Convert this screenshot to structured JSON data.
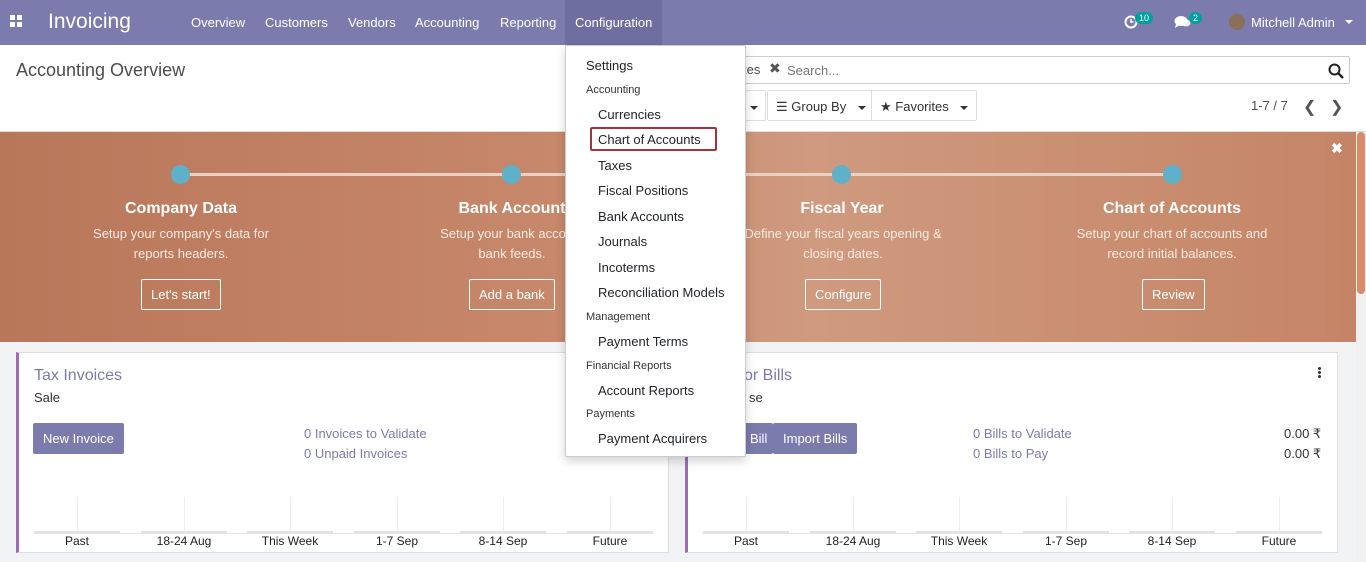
{
  "navbar": {
    "brand": "Invoicing",
    "menu": [
      "Overview",
      "Customers",
      "Vendors",
      "Accounting",
      "Reporting",
      "Configuration"
    ],
    "activity_count": "10",
    "message_count": "2",
    "user_name": "Mitchell Admin",
    "icons": [
      "apps-grid-icon",
      "clock-icon",
      "chat-icon",
      "avatar"
    ]
  },
  "control": {
    "title": "Accounting Overview",
    "facet_label": "tes",
    "search_placeholder": "Search...",
    "group_by": "Group By",
    "favorites": "Favorites",
    "pager": "1-7 / 7"
  },
  "banner": {
    "steps": [
      {
        "title": "Company Data",
        "desc1": "Setup your company's data for",
        "desc2": "reports headers.",
        "button": "Let's start!"
      },
      {
        "title": "Bank Account",
        "desc1": "Setup your bank account",
        "desc2": "bank feeds.",
        "button": "Add a bank"
      },
      {
        "title": "Fiscal Year",
        "desc1": "Define your fiscal years opening &",
        "desc2": "closing dates.",
        "button": "Configure"
      },
      {
        "title": "Chart of Accounts",
        "desc1": "Setup your chart of accounts and",
        "desc2": "record initial balances.",
        "button": "Review"
      }
    ],
    "close": "✖"
  },
  "cards": {
    "tax": {
      "title": "Tax Invoices",
      "subtitle": "Sale",
      "button": "New Invoice",
      "link1": "0 Invoices to Validate",
      "link2": "0 Unpaid Invoices"
    },
    "vendor": {
      "title": "or Bills",
      "subtitle": "se",
      "button_partial": "Bill",
      "button_import": "Import Bills",
      "link1": "0 Bills to Validate",
      "link2": "0 Bills to Pay",
      "amount1": "0.00 ₹",
      "amount2": "0.00 ₹"
    },
    "chart_labels": [
      "Past",
      "18-24 Aug",
      "This Week",
      "1-7 Sep",
      "8-14 Sep",
      "Future"
    ]
  },
  "dropdown": {
    "settings": "Settings",
    "accounting_header": "Accounting",
    "accounting_items": [
      "Currencies",
      "Chart of Accounts",
      "Taxes",
      "Fiscal Positions",
      "Bank Accounts",
      "Journals",
      "Incoterms",
      "Reconciliation Models"
    ],
    "management_header": "Management",
    "management_items": [
      "Payment Terms"
    ],
    "financial_header": "Financial Reports",
    "financial_items": [
      "Account Reports"
    ],
    "payments_header": "Payments",
    "payments_items": [
      "Payment Acquirers"
    ]
  },
  "colors": {
    "navbar": "#7c7bad",
    "banner": "#c7876a",
    "step_dot": "#5fb0c9",
    "highlight": "#a8323c",
    "card_accent": "#9b6db4"
  }
}
